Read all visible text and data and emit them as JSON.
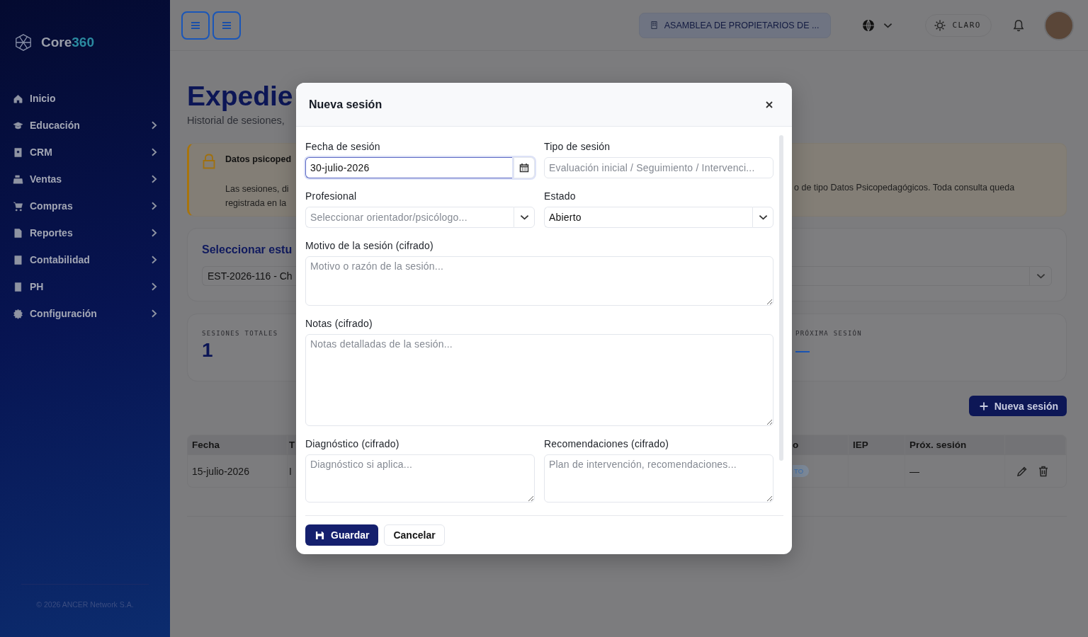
{
  "sidebar": {
    "brand_name": "Core",
    "brand_accent": "360",
    "items": [
      {
        "label": "Inicio",
        "expandable": false
      },
      {
        "label": "Educación",
        "expandable": true
      },
      {
        "label": "CRM",
        "expandable": true
      },
      {
        "label": "Ventas",
        "expandable": true
      },
      {
        "label": "Compras",
        "expandable": true
      },
      {
        "label": "Reportes",
        "expandable": true
      },
      {
        "label": "Contabilidad",
        "expandable": true
      },
      {
        "label": "PH",
        "expandable": true
      },
      {
        "label": "Configuración",
        "expandable": true
      }
    ],
    "footer": "© 2026 ANCER Network S.A."
  },
  "topbar": {
    "organization": "ASAMBLEA DE PROPIETARIOS DE ...",
    "theme_label": "CLARO"
  },
  "page": {
    "title": "Expedie",
    "subtitle": "Historial de sesiones,"
  },
  "alert": {
    "title": "Datos psicoped",
    "lines_left": [
      "Las sesiones, di",
      "registrada en la"
    ],
    "line_right": "o de tipo Datos Psicopedagógicos. Toda consulta queda"
  },
  "student_select": {
    "heading": "Seleccionar estu",
    "value": "EST-2026-116 - Ch"
  },
  "stats": [
    {
      "label": "SESIONES TOTALES",
      "value": "1"
    },
    {
      "label": "PRÓXIMA SESIÓN",
      "value": "—"
    }
  ],
  "new_session_button": "Nueva sesión",
  "table": {
    "columns_left": [
      "Fecha",
      "T"
    ],
    "columns_right": [
      "o",
      "IEP",
      "Próx. sesión"
    ],
    "rows": [
      {
        "date": "15-julio-2026",
        "type": "I",
        "status": "TO",
        "next_session": "—"
      }
    ]
  },
  "modal": {
    "title": "Nueva sesión",
    "rows": [
      [
        {
          "kind": "date",
          "label": "Fecha de sesión",
          "value": "30-julio-2026",
          "focused": true
        },
        {
          "kind": "text",
          "label": "Tipo de sesión",
          "placeholder": "Evaluación inicial / Seguimiento / Intervenci...",
          "focused": false
        }
      ],
      [
        {
          "kind": "select",
          "label": "Profesional",
          "placeholder": "Seleccionar orientador/psicólogo...",
          "focused": false
        },
        {
          "kind": "select",
          "label": "Estado",
          "value": "Abierto",
          "focused": false
        }
      ],
      [
        {
          "kind": "textarea",
          "label": "Motivo de la sesión (cifrado)",
          "placeholder": "Motivo o razón de la sesión...",
          "focused": false
        }
      ],
      [
        {
          "kind": "textarea",
          "label": "Notas (cifrado)",
          "placeholder": "Notas detalladas de la sesión...",
          "focused": false
        }
      ],
      [
        {
          "kind": "textarea",
          "label": "Diagnóstico (cifrado)",
          "placeholder": "Diagnóstico si aplica...",
          "focused": false
        },
        {
          "kind": "textarea",
          "label": "Recomendaciones (cifrado)",
          "placeholder": "Plan de intervención, recomendaciones...",
          "focused": false
        }
      ]
    ],
    "save_button": "Guardar",
    "cancel_button": "Cancelar"
  }
}
